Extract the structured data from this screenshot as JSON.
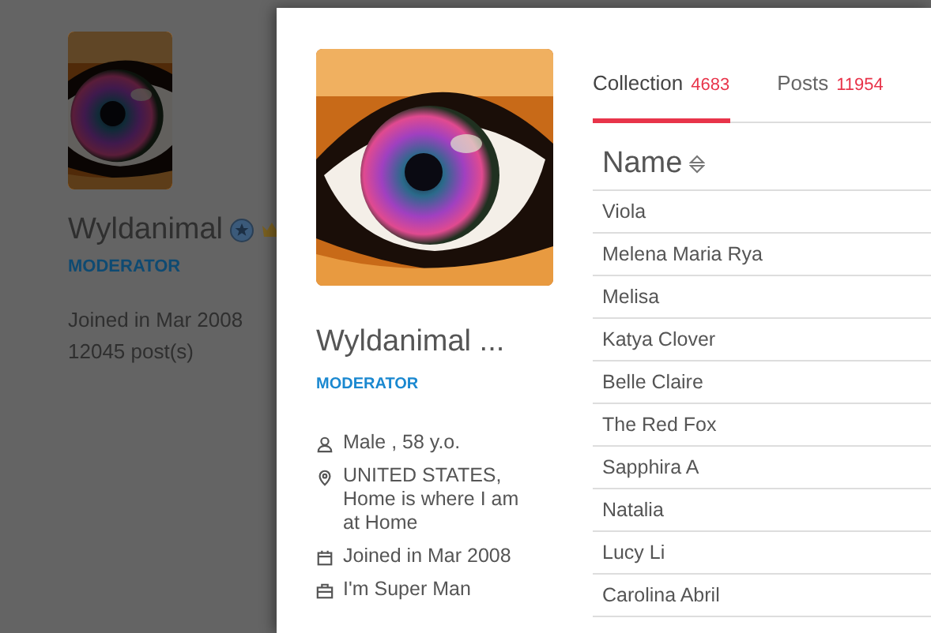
{
  "background_profile": {
    "name": "Wyldanimal",
    "role": "MODERATOR",
    "joined": "Joined in Mar 2008",
    "posts": "12045 post(s)"
  },
  "profile": {
    "name": "Wyldanimal ...",
    "role": "MODERATOR",
    "details": [
      {
        "kind": "gender",
        "text": "Male , 58 y.o."
      },
      {
        "kind": "location",
        "text": "UNITED STATES, Home is where I am at Home"
      },
      {
        "kind": "joined",
        "text": "Joined in Mar 2008"
      },
      {
        "kind": "occupation",
        "text": "I'm Super Man"
      }
    ]
  },
  "tabs": [
    {
      "label": "Collection",
      "count": "4683",
      "selected": true
    },
    {
      "label": "Posts",
      "count": "11954",
      "selected": false
    }
  ],
  "table": {
    "columns": [
      "Name"
    ],
    "rows": [
      "Viola",
      "Melena Maria Rya",
      "Melisa",
      "Katya Clover",
      "Belle Claire",
      "The Red Fox",
      "Sapphira A",
      "Natalia",
      "Lucy Li",
      "Carolina Abril"
    ]
  }
}
